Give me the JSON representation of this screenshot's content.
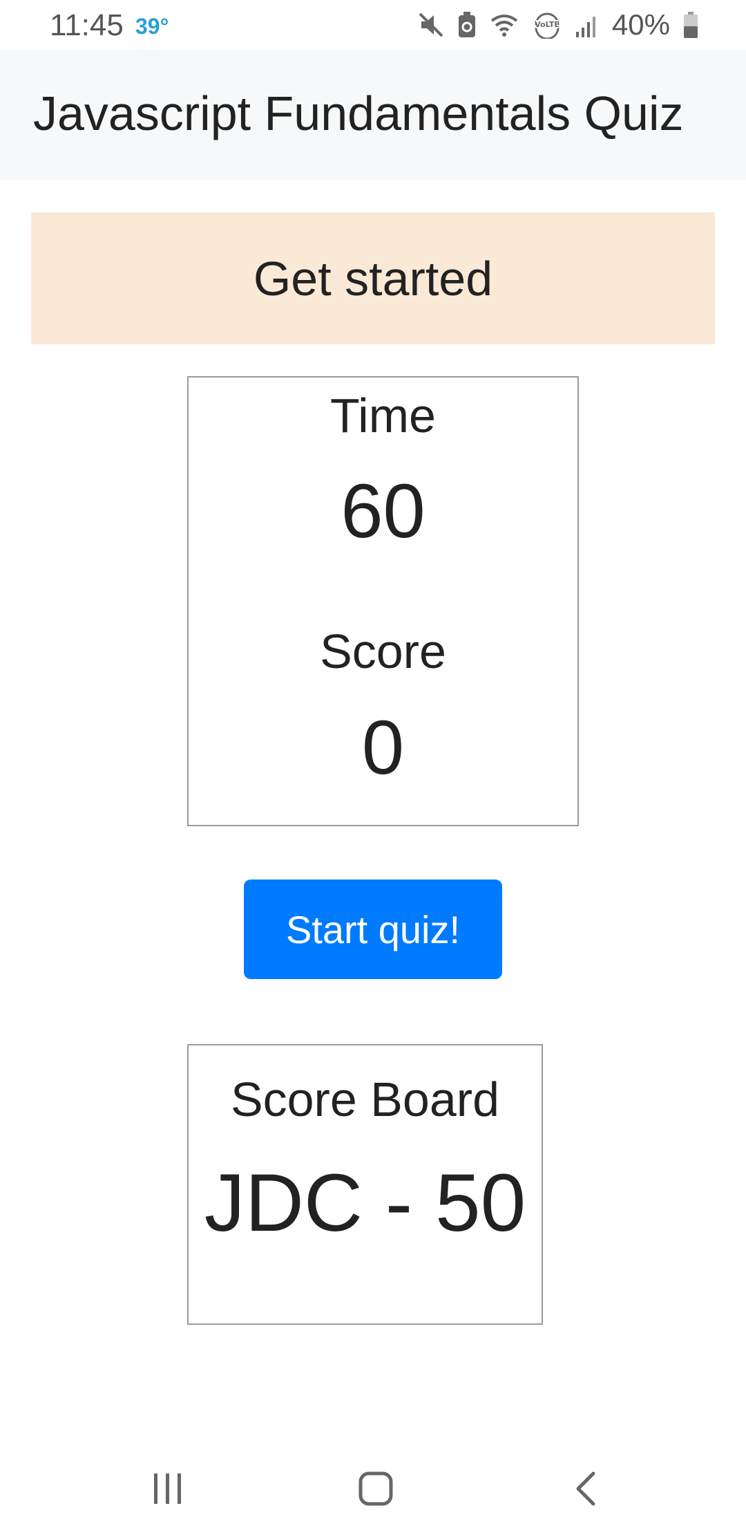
{
  "status_bar": {
    "time": "11:45",
    "temperature": "39°",
    "battery": "40%",
    "icons": [
      "mute-icon",
      "battery-saver-icon",
      "wifi-icon",
      "volte-icon",
      "signal-icon",
      "battery-icon"
    ],
    "temperature_color": "#2aa0d8"
  },
  "header": {
    "title": "Javascript Fundamentals Quiz"
  },
  "banner": {
    "text": "Get started",
    "background": "#fae9d6"
  },
  "stats": {
    "time_label": "Time",
    "time_value": "60",
    "score_label": "Score",
    "score_value": "0"
  },
  "start_button": {
    "label": "Start quiz!",
    "color": "#007bff"
  },
  "scoreboard": {
    "title": "Score Board",
    "entries": [
      "JDC - 50"
    ]
  },
  "bottom_nav": {
    "icons": [
      "recent-apps-icon",
      "home-icon",
      "back-icon"
    ]
  }
}
